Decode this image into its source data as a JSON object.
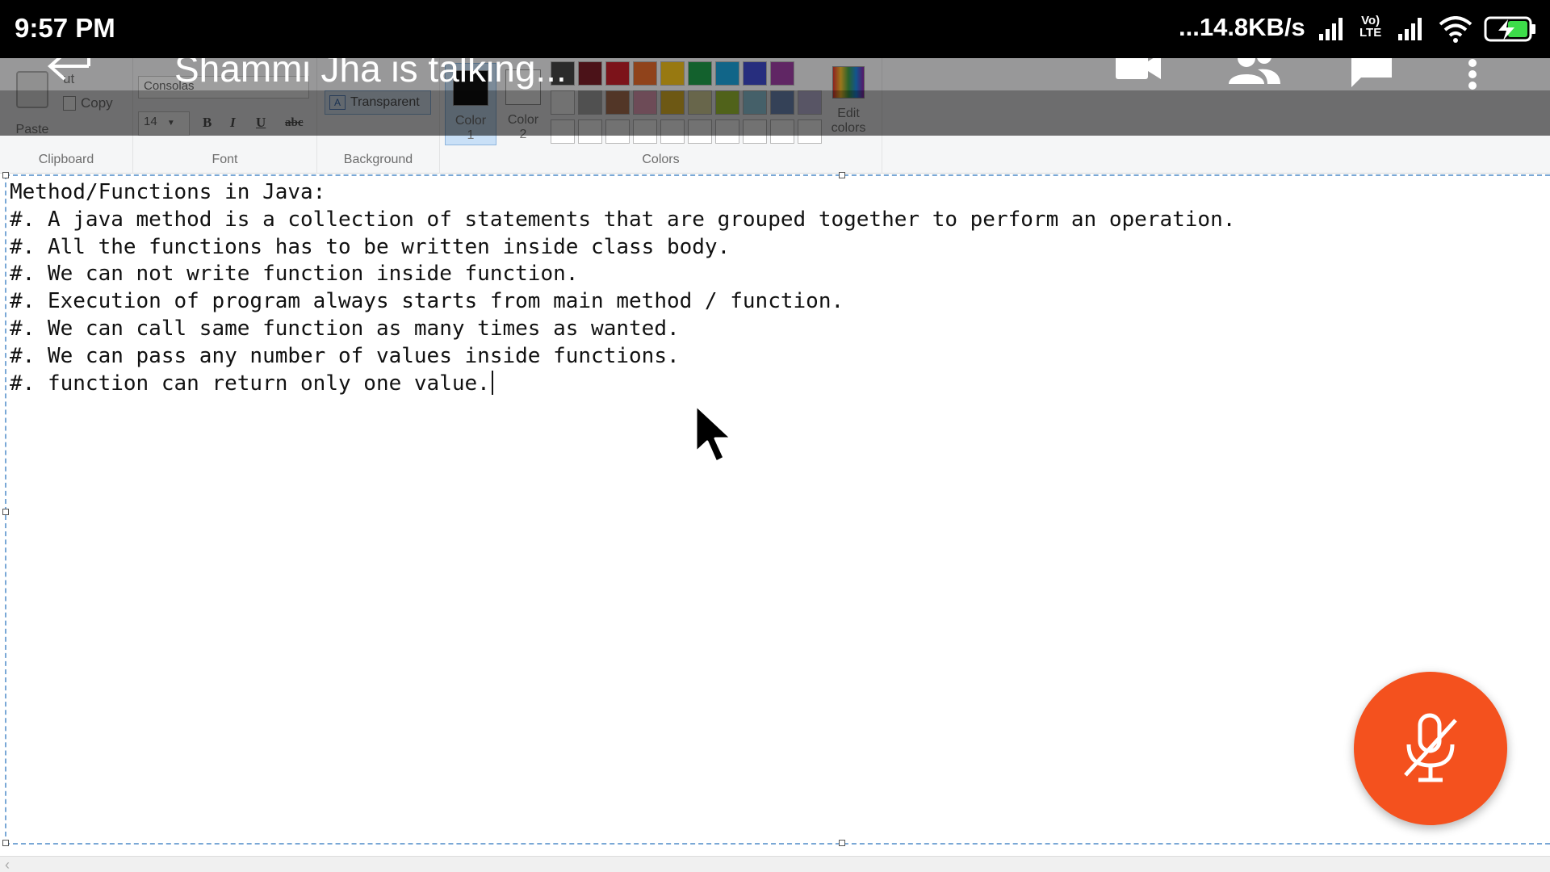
{
  "status_bar": {
    "time": "9:57 PM",
    "network_speed": "...14.8KB/s",
    "network_type": "LTE",
    "icons": [
      "signal-icon",
      "volte-icon",
      "signal-icon",
      "wifi-icon",
      "battery-charging-icon"
    ]
  },
  "call": {
    "status_text": "Shammi Jha is talking...",
    "icons": [
      "back-icon",
      "video-camera-icon",
      "people-icon",
      "chat-icon",
      "more-vert-icon"
    ],
    "mic_state": "muted",
    "mic_icon": "mic-off-icon",
    "accent_color": "#f4511e"
  },
  "ribbon": {
    "groups": {
      "clipboard": "Clipboard",
      "font": "Font",
      "background": "Background",
      "colors": "Colors"
    },
    "paste_label": "Paste",
    "cut_label": "ut",
    "copy_label": "Copy",
    "font_name": "Consolas",
    "font_size": "14",
    "bold": "B",
    "italic": "I",
    "underline": "U",
    "strike": "abc",
    "transparent_label": "Transparent",
    "color1_label": "Color\n1",
    "color2_label": "Color\n2",
    "edit_colors_label": "Edit\ncolors",
    "palette_row1": [
      "#464646",
      "#7a1d28",
      "#c8202b",
      "#e96c2d",
      "#f5c41c",
      "#1f9d4a",
      "#1ca3dc",
      "#3f4bcc",
      "#9b3ea2"
    ],
    "palette_row2": [
      "#ffffff",
      "#b4b4b4",
      "#b87a59",
      "#f5a8c4",
      "#f6c730",
      "#ebe6a8",
      "#b5dc3a",
      "#9cd8ec",
      "#7692c4",
      "#c7bfe3"
    ]
  },
  "document": {
    "lines": [
      "Method/Functions in Java:",
      "#. A java method is a collection of statements that are grouped together to perform an operation.",
      "#. All the functions has to be written inside class body.",
      "#. We can not write function inside function.",
      "#. Execution of program always starts from main method / function.",
      "#. We can call same function as many times as wanted.",
      "#. We can pass any number of values inside functions.",
      "#. function can return only one value."
    ]
  }
}
